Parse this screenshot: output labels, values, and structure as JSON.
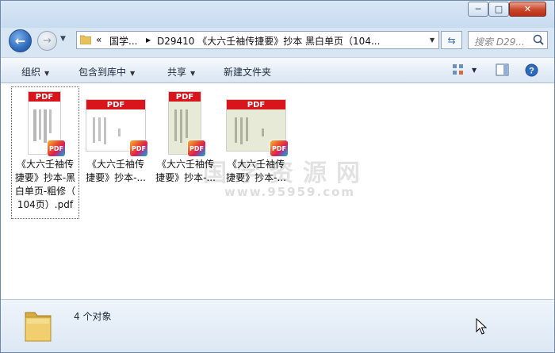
{
  "window": {
    "controls": {
      "minimize": "─",
      "maximize": "□",
      "close": "✕"
    }
  },
  "nav": {
    "back_icon": "arrow-left-icon",
    "forward_icon": "arrow-right-icon",
    "breadcrumb": [
      "«",
      "国学...",
      "D29410 《大六壬袖传捷要》抄本 黑白单页（104..."
    ],
    "search_placeholder": "搜索 D29..."
  },
  "toolbar": {
    "organize": "组织",
    "include_library": "包含到库中",
    "share": "共享",
    "new_folder": "新建文件夹"
  },
  "files": [
    {
      "name": "《大六壬袖传捷要》抄本-黑白单页-粗修（104页）.pdf",
      "display_lines": [
        "《大六壬袖传",
        "捷要》抄本-黑",
        "白单页-粗修（",
        "104页）.pdf"
      ],
      "badge": "PDF",
      "band": "PDF",
      "selected": true
    },
    {
      "name": "《大六壬袖传捷要》抄本-...",
      "display_lines": [
        "《大六壬袖传",
        "捷要》抄本-..."
      ],
      "badge": "PDF",
      "band": "PDF",
      "selected": false
    },
    {
      "name": "《大六壬袖传捷要》抄本-...",
      "display_lines": [
        "《大六壬袖传",
        "捷要》抄本-..."
      ],
      "badge": "PDF",
      "band": "PDF",
      "selected": false
    },
    {
      "name": "《大六壬袖传捷要》抄本-...",
      "display_lines": [
        "《大六壬袖传",
        "捷要》抄本-..."
      ],
      "badge": "PDF",
      "band": "PDF",
      "selected": false
    }
  ],
  "watermark": {
    "line1": "国学资源网",
    "line2": "www.95959.com"
  },
  "status": {
    "count_text": "4 个对象"
  },
  "colors": {
    "pdf_red": "#d8141c",
    "window_frame": "#d8e6f3",
    "accent_blue": "#2f6bbd"
  }
}
